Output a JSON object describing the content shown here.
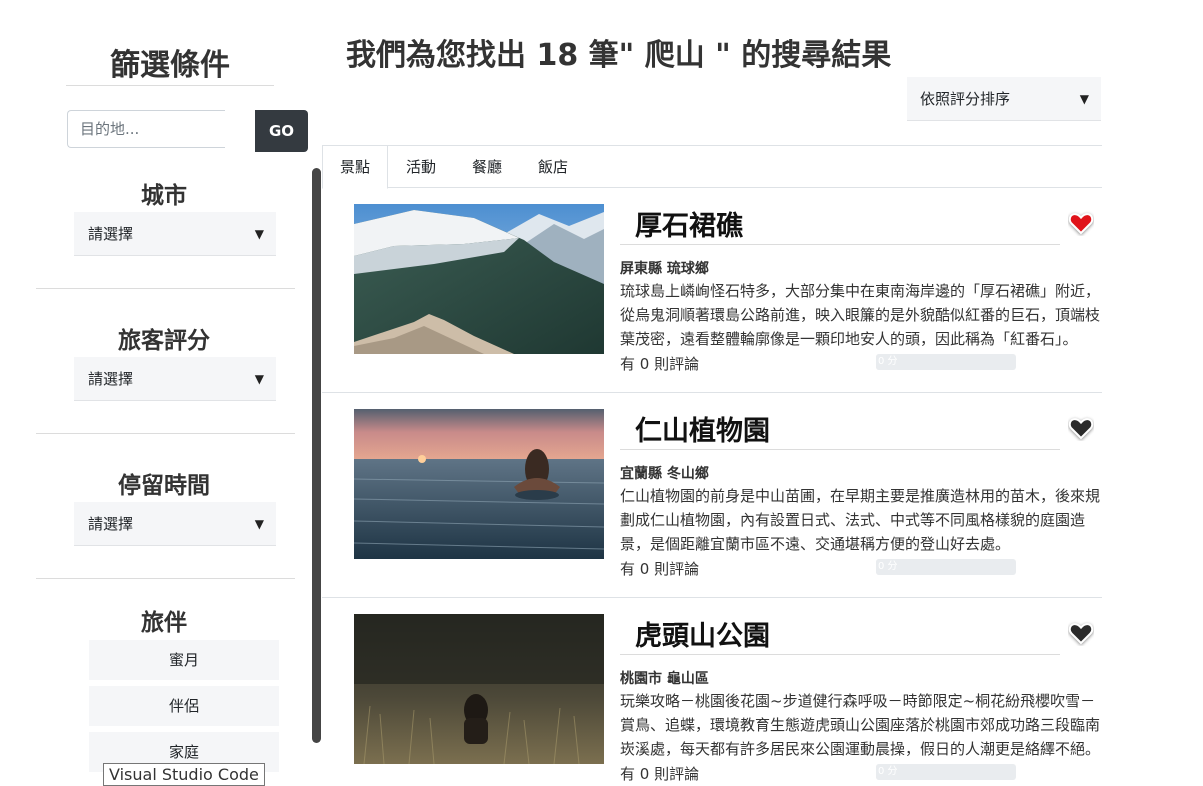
{
  "sidebar": {
    "title": "篩選條件",
    "search": {
      "placeholder": "目的地...",
      "value": "",
      "button_label": "GO"
    },
    "city": {
      "title": "城市",
      "selected": "請選擇"
    },
    "rating": {
      "title": "旅客評分",
      "selected": "請選擇"
    },
    "duration": {
      "title": "停留時間",
      "selected": "請選擇"
    },
    "companion": {
      "title": "旅伴",
      "options": [
        "蜜月",
        "伴侶",
        "家庭"
      ]
    }
  },
  "main": {
    "title": "我們為您找出 18 筆\" 爬山 \" 的搜尋結果",
    "sort": {
      "selected": "依照評分排序"
    },
    "tabs": [
      {
        "label": "景點",
        "active": true
      },
      {
        "label": "活動",
        "active": false
      },
      {
        "label": "餐廳",
        "active": false
      },
      {
        "label": "飯店",
        "active": false
      }
    ],
    "results": [
      {
        "name": "厚石裙礁",
        "location": "屏東縣 琉球鄉",
        "description": "琉球島上嶙峋怪石特多，大部分集中在東南海岸邊的「厚石裙礁」附近，從烏鬼洞順著環島公路前進，映入眼簾的是外貌酷似紅番的巨石，頂端枝葉茂密，遠看整體輪廓像是一顆印地安人的頭，因此稱為「紅番石」。",
        "reviews": "有 0 則評論",
        "rating_label": "0 分",
        "rating": 0,
        "favorited": true,
        "image": "snowy-mountain"
      },
      {
        "name": "仁山植物園",
        "location": "宜蘭縣 冬山鄉",
        "description": "仁山植物園的前身是中山苗圃，在早期主要是推廣造林用的苗木，後來規劃成仁山植物園，內有設置日式、法式、中式等不同風格樣貌的庭園造景，是個距離宜蘭市區不遠、交通堪稱方便的登山好去處。",
        "reviews": "有 0 則評論",
        "rating_label": "0 分",
        "rating": 0,
        "favorited": false,
        "image": "sunset-sea"
      },
      {
        "name": "虎頭山公園",
        "location": "桃園市 龜山區",
        "description": "玩樂攻略－桃園後花園~步道健行森呼吸－時節限定~桐花紛飛櫻吹雪－賞鳥、追蝶，環境教育生態遊虎頭山公園座落於桃園市郊成功路三段臨南崁溪處，每天都有許多居民來公園運動晨操，假日的人潮更是絡繹不絕。",
        "reviews": "有 0 則評論",
        "rating_label": "0 分",
        "rating": 0,
        "favorited": false,
        "image": "grass-field"
      }
    ]
  },
  "tooltip": {
    "text": "Visual Studio Code"
  },
  "colors": {
    "dark_button": "#343a40",
    "select_bg": "#f5f6f8",
    "heart_active": "#e0131a",
    "heart_inactive": "#2b2b2b"
  }
}
